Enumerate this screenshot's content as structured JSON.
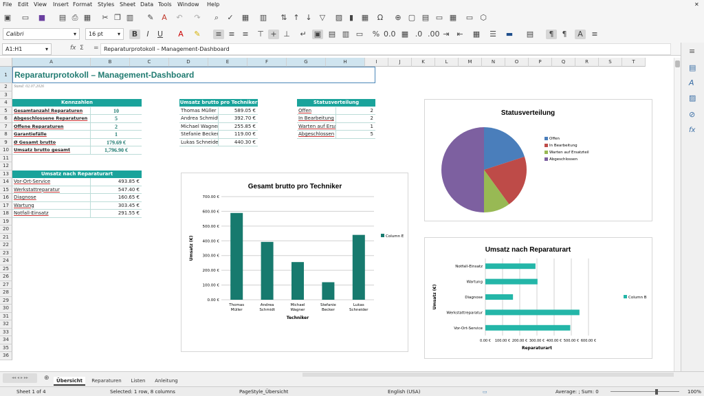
{
  "menu": [
    "File",
    "Edit",
    "View",
    "Insert",
    "Format",
    "Styles",
    "Sheet",
    "Data",
    "Tools",
    "Window",
    "Help"
  ],
  "toolbar": {
    "font_name": "Calibri",
    "font_size": "16 pt"
  },
  "formula_bar": {
    "cell_ref": "A1:H1",
    "content": "Reparaturprotokoll – Management-Dashboard",
    "fx": "fx",
    "sigma": "Σ",
    "eq": "="
  },
  "columns": [
    "A",
    "B",
    "C",
    "D",
    "E",
    "F",
    "G",
    "H",
    "I",
    "J",
    "K",
    "L",
    "M",
    "N",
    "O",
    "P",
    "Q",
    "R",
    "S",
    "T"
  ],
  "rows": [
    "1",
    "2",
    "3",
    "4",
    "5",
    "6",
    "7",
    "8",
    "9",
    "10",
    "11",
    "12",
    "13",
    "14",
    "15",
    "16",
    "17",
    "18",
    "19",
    "20",
    "21",
    "22",
    "23",
    "24",
    "25",
    "26",
    "27",
    "28",
    "29",
    "30",
    "31",
    "32",
    "33",
    "34",
    "35",
    "36"
  ],
  "sheet": {
    "title": "Reparaturprotokoll – Management-Dashboard",
    "date": "Stand: 02.07.2026",
    "kpi": {
      "header": "Kennzahlen",
      "items": [
        {
          "label": "Gesamtanzahl Reparaturen",
          "value": "10"
        },
        {
          "label": "Abgeschlossene Reparaturen",
          "value": "5"
        },
        {
          "label": "Offene Reparaturen",
          "value": "2"
        },
        {
          "label": "Garantiefälle",
          "value": "1"
        },
        {
          "label": "Ø Gesamt brutto",
          "value": "179.69 €"
        },
        {
          "label": "Umsatz brutto gesamt",
          "value": "1,796.90 €"
        }
      ]
    },
    "art": {
      "header": "Umsatz nach Reparaturart",
      "items": [
        {
          "label": "Vor-Ort-Service",
          "value": "493.85 €"
        },
        {
          "label": "Werkstattreparatur",
          "value": "547.40 €"
        },
        {
          "label": "Diagnose",
          "value": "160.65 €"
        },
        {
          "label": "Wartung",
          "value": "303.45 €"
        },
        {
          "label": "Notfall-Einsatz",
          "value": "291.55 €"
        }
      ]
    },
    "tech": {
      "header": "Umsatz brutto pro Techniker",
      "items": [
        {
          "label": "Thomas Müller",
          "value": "589.05 €"
        },
        {
          "label": "Andrea Schmidt",
          "value": "392.70 €"
        },
        {
          "label": "Michael Wagner",
          "value": "255.85 €"
        },
        {
          "label": "Stefanie Becker",
          "value": "119.00 €"
        },
        {
          "label": "Lukas Schneider",
          "value": "440.30 €"
        }
      ]
    },
    "status": {
      "header": "Statusverteilung",
      "items": [
        {
          "label": "Offen",
          "value": "2"
        },
        {
          "label": "In Bearbeitung",
          "value": "2"
        },
        {
          "label": "Warten auf Ersatzteil",
          "value": "1"
        },
        {
          "label": "Abgeschlossen",
          "value": "5"
        }
      ]
    }
  },
  "chart_data": [
    {
      "type": "bar",
      "title": "Gesamt brutto pro Techniker",
      "xlabel": "Techniker",
      "ylabel": "Umsatz (€)",
      "categories": [
        "Thomas Müller",
        "Andrea Schmidt",
        "Michael Wagner",
        "Stefanie Becker",
        "Lukas Schneider"
      ],
      "series": [
        {
          "name": "Column E",
          "values": [
            589.05,
            392.7,
            255.85,
            119.0,
            440.3
          ]
        }
      ],
      "ylim": [
        0,
        700
      ],
      "yticks": [
        "0.00 €",
        "100.00 €",
        "200.00 €",
        "300.00 €",
        "400.00 €",
        "500.00 €",
        "600.00 €",
        "700.00 €"
      ],
      "color": "#177a6e",
      "legend": "right"
    },
    {
      "type": "pie",
      "title": "Statusverteilung",
      "categories": [
        "Offen",
        "In Bearbeitung",
        "Warten auf Ersatzteil",
        "Abgeschlossen"
      ],
      "values": [
        2,
        2,
        1,
        5
      ],
      "colors": [
        "#4a7ebb",
        "#be4b48",
        "#98b954",
        "#7d60a0"
      ],
      "legend": "right"
    },
    {
      "type": "bar",
      "orientation": "horizontal",
      "title": "Umsatz nach Reparaturart",
      "xlabel": "Reparaturart",
      "ylabel": "Umsatz (€)",
      "categories": [
        "Vor-Ort-Service",
        "Werkstattreparatur",
        "Diagnose",
        "Wartung",
        "Notfall-Einsatz"
      ],
      "series": [
        {
          "name": "Column B",
          "values": [
            493.85,
            547.4,
            160.65,
            303.45,
            291.55
          ]
        }
      ],
      "xlim": [
        0,
        600
      ],
      "xticks": [
        "0.00 €",
        "100.00 €",
        "200.00 €",
        "300.00 €",
        "400.00 €",
        "500.00 €",
        "600.00 €"
      ],
      "color": "#24b6a8",
      "legend": "right"
    }
  ],
  "tabs": [
    "Übersicht",
    "Reparaturen",
    "Listen",
    "Anleitung"
  ],
  "status": {
    "sheet": "Sheet 1 of 4",
    "selection": "Selected: 1 row, 8 columns",
    "pagestyle": "PageStyle_Übersicht",
    "language": "English (USA)",
    "sum": "Average: ; Sum: 0",
    "zoom": "100%"
  }
}
